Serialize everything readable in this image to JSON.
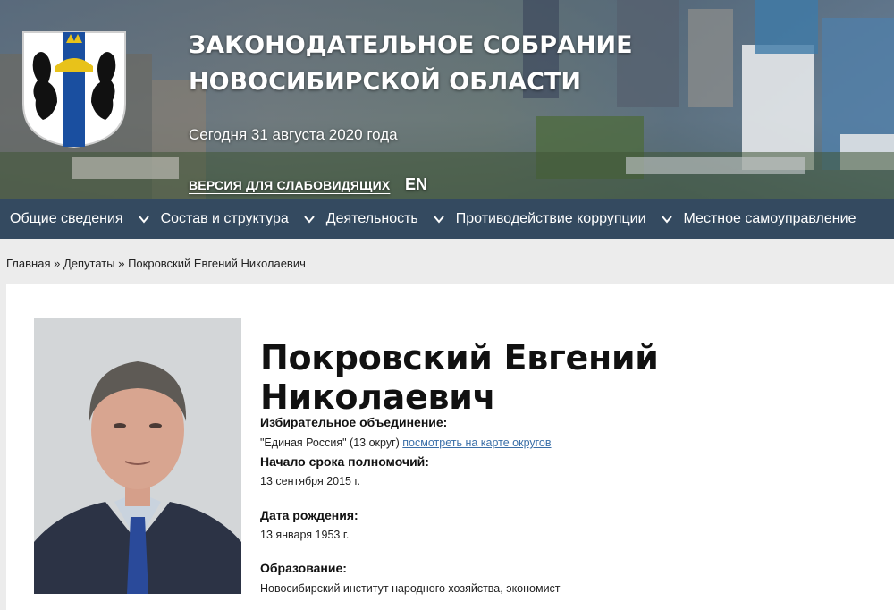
{
  "header": {
    "title_line1": "ЗАКОНОДАТЕЛЬНОЕ СОБРАНИЕ",
    "title_line2": "НОВОСИБИРСКОЙ ОБЛАСТИ",
    "date_text": "Сегодня 31 августа 2020 года",
    "accessibility_label": "ВЕРСИЯ ДЛЯ СЛАБОВИДЯЩИХ",
    "lang_label": "EN"
  },
  "nav": {
    "items": [
      {
        "label": "Общие сведения"
      },
      {
        "label": "Состав и структура"
      },
      {
        "label": "Деятельность"
      },
      {
        "label": "Противодействие коррупции"
      },
      {
        "label": "Местное самоуправление"
      }
    ]
  },
  "breadcrumb": {
    "home": "Главная",
    "sep1": "»",
    "section": "Депутаты",
    "sep2": "»",
    "current": "Покровский Евгений Николаевич"
  },
  "profile": {
    "name": "Покровский Евгений Николаевич",
    "party_label": "Избирательное объединение:",
    "party_value": "\"Единая Россия\" (13 округ)",
    "party_map_link": "посмотреть на карте округов",
    "term_label": "Начало срока полномочий:",
    "term_value": "13 сентября 2015 г.",
    "birth_label": "Дата рождения:",
    "birth_value": "13 января 1953 г.",
    "education_label": "Образование:",
    "education_value": "Новосибирский институт народного хозяйства, экономист"
  },
  "colors": {
    "nav_bg": "#344a60",
    "link": "#3a6fa8",
    "emblem_blue": "#1a4fa0",
    "emblem_gold": "#e8c21a"
  }
}
